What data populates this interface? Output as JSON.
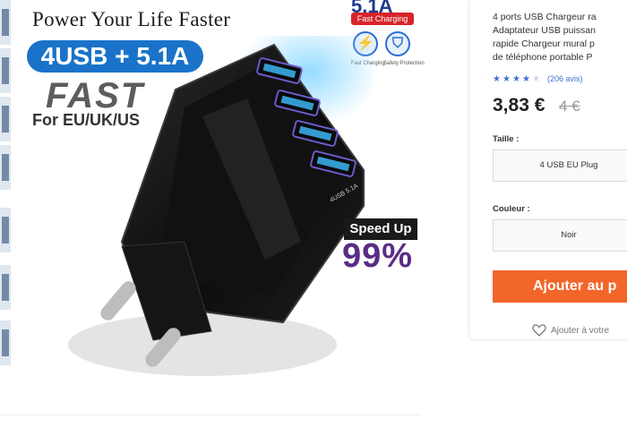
{
  "hero": {
    "tagline": "Power Your Life Faster",
    "spec_pill": "4USB + 5.1A",
    "fast_word": "FAST",
    "regions": "For EU/UK/US",
    "badge_current": "5.1A",
    "badge_label": "Fast Charging",
    "icon1_caption": "Fast Charging",
    "icon2_caption": "Safety Protection",
    "speed_label": "Speed Up",
    "speed_value": "99%",
    "charger_label": "4USB 5.1A"
  },
  "product": {
    "title_lines": [
      "4 ports USB  Chargeur ra",
      "Adaptateur USB puissan",
      "rapide Chargeur mural p",
      "de téléphone portable P"
    ],
    "rating_value": 4,
    "rating_max": 5,
    "reviews": "(206 avis)",
    "price": "3,83 €",
    "old_price": "4 €",
    "size_label": "Taille :",
    "size_value": "4 USB EU Plug",
    "color_label": "Couleur :",
    "color_value": "Noir",
    "add_to_cart": "Ajouter au p",
    "wishlist": "Ajouter à votre"
  },
  "colors": {
    "accent_blue": "#1a73c9",
    "cta_orange": "#f2662a",
    "star_blue": "#3f6fd3",
    "speed_purple": "#5a2c86"
  }
}
